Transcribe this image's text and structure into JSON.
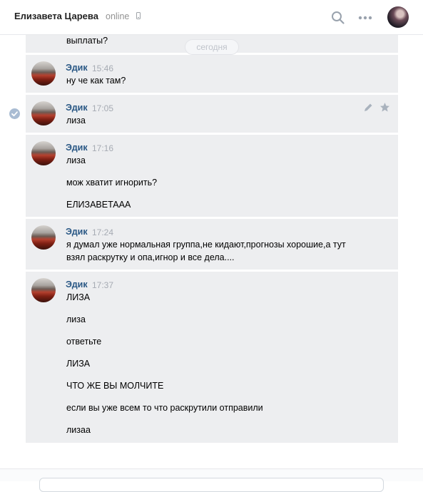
{
  "header": {
    "contact_name": "Елизавета Царева",
    "status": "online",
    "icons": [
      "search-icon",
      "more-icon",
      "phone-icon"
    ]
  },
  "date_separator": "сегодня",
  "first_message_tail": "выплаты?",
  "messages": [
    {
      "author": "Эдик",
      "time": "15:46",
      "lines": [
        "ну че как там?"
      ]
    },
    {
      "author": "Эдик",
      "time": "17:05",
      "lines": [
        "лиза"
      ]
    },
    {
      "author": "Эдик",
      "time": "17:16",
      "lines": [
        "лиза",
        "мож хватит игнорить?",
        "ЕЛИЗАВЕТААА"
      ]
    },
    {
      "author": "Эдик",
      "time": "17:24",
      "lines": [
        "я думал уже нормальная группа,не кидают,прогнозы хорошие,а тут",
        "взял раскрутку и опа,игнор и все дела...."
      ]
    },
    {
      "author": "Эдик",
      "time": "17:37",
      "lines": [
        "ЛИЗА",
        "лиза",
        "ответьте",
        "ЛИЗА",
        "ЧТО ЖЕ ВЫ МОЛЧИТЕ",
        "если вы уже всем то что раскрутили отправили",
        "лизаа"
      ]
    }
  ],
  "colors": {
    "message_bg": "#edeef0",
    "author": "#2a5885",
    "time": "#a6abb3"
  }
}
